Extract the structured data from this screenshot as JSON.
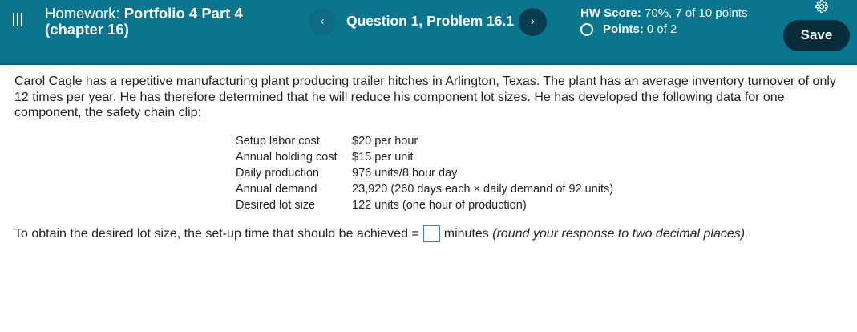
{
  "header": {
    "hw_prefix": "Homework:",
    "hw_name": "Portfolio 4 Part 4",
    "hw_name_line2": "(chapter 16)",
    "question_label": "Question 1, Problem 16.1",
    "nav_prev_glyph": "‹",
    "nav_next_glyph": "›",
    "score_label": "HW Score:",
    "score_value": "70%, 7 of 10 points",
    "points_label": "Points:",
    "points_value": "0 of 2",
    "save_label": "Save",
    "icons": [
      "menu-icon",
      "chevron-left-icon",
      "chevron-right-icon",
      "gear-icon",
      "status-circle-icon"
    ]
  },
  "problem": {
    "intro": "Carol Cagle has a repetitive manufacturing plant producing trailer hitches in Arlington, Texas. The plant has an average inventory turnover of only 12 times per year. He has therefore determined that he will reduce his component lot sizes. He has developed the following data for one component, the safety chain clip:",
    "data_rows": [
      {
        "label": "Setup labor cost",
        "value": "$20 per hour"
      },
      {
        "label": "Annual holding cost",
        "value": "$15 per unit"
      },
      {
        "label": "Daily production",
        "value": "976 units/8 hour day"
      },
      {
        "label": "Annual demand",
        "value": "23,920 (260 days each × daily demand of 92 units)"
      },
      {
        "label": "Desired lot size",
        "value": "122 units (one hour of production)"
      }
    ],
    "answer_prefix": "To obtain the desired lot size, the set-up time that should be achieved =",
    "answer_value": "",
    "answer_suffix": "minutes",
    "answer_hint": "(round your response to two decimal places)."
  },
  "colors": {
    "header_bg": "#0b7590",
    "save_bg": "#0a2d3b",
    "answer_box_border": "#3c84c4"
  }
}
